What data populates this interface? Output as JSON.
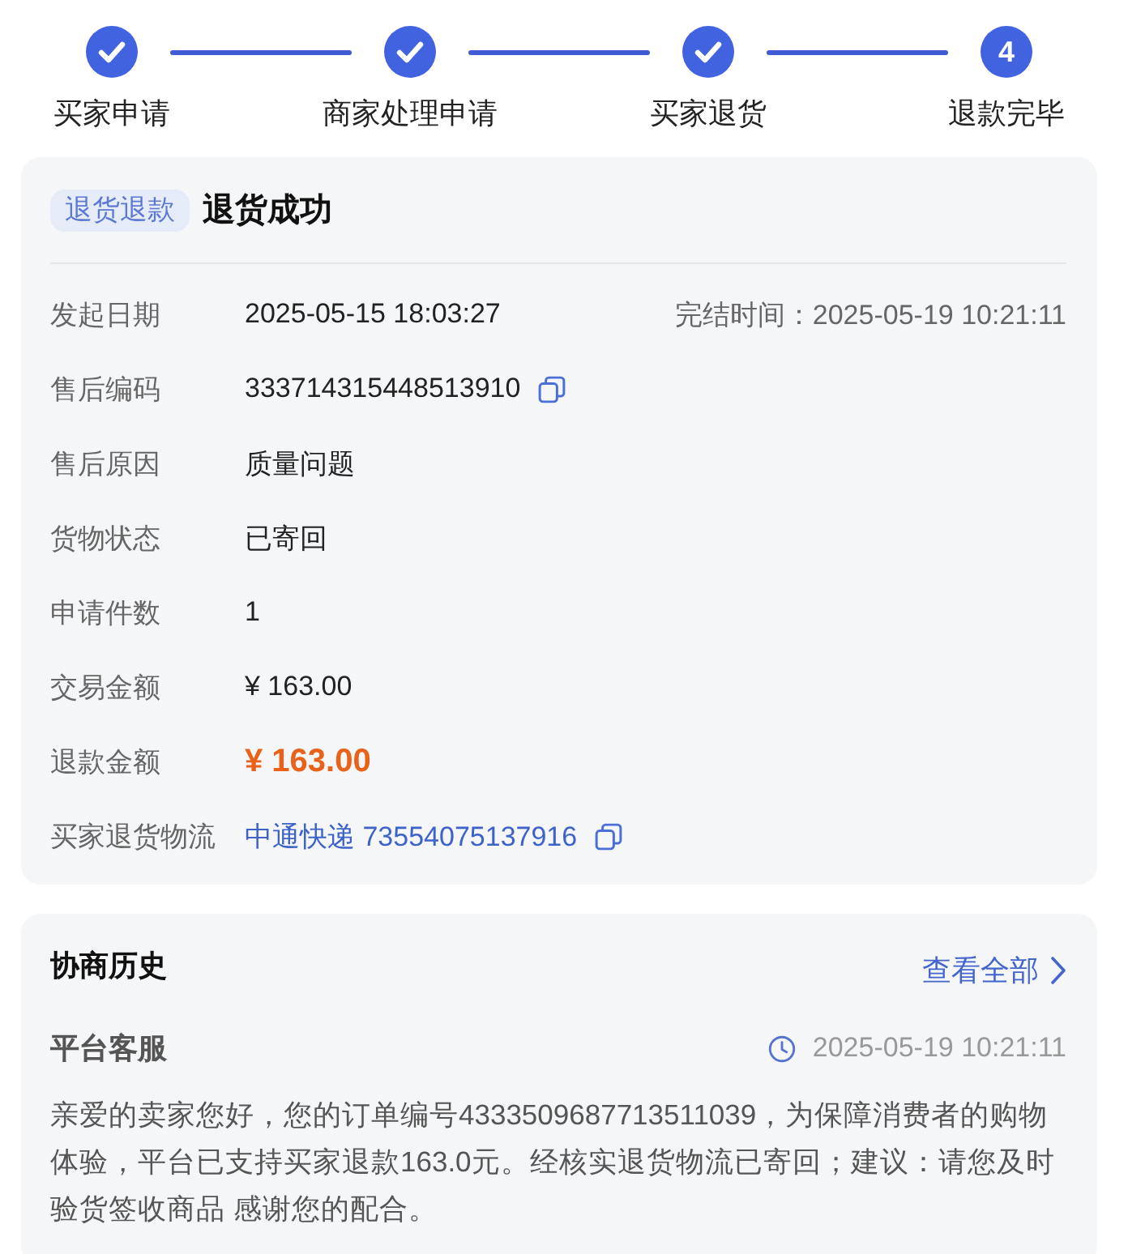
{
  "steps": [
    {
      "label": "买家申请",
      "kind": "done"
    },
    {
      "label": "商家处理申请",
      "kind": "done"
    },
    {
      "label": "买家退货",
      "kind": "done"
    },
    {
      "label": "退款完毕",
      "kind": "current",
      "number": "4"
    }
  ],
  "summary": {
    "tag": "退货退款",
    "title": "退货成功"
  },
  "details": [
    {
      "label": "发起日期",
      "value": "2025-05-15 18:03:27",
      "kind": "plain",
      "copyable": false,
      "aside": "完结时间：2025-05-19 10:21:11"
    },
    {
      "label": "售后编码",
      "value": "333714315448513910",
      "kind": "plain",
      "copyable": true
    },
    {
      "label": "售后原因",
      "value": "质量问题",
      "kind": "plain",
      "copyable": false
    },
    {
      "label": "货物状态",
      "value": "已寄回",
      "kind": "plain",
      "copyable": false
    },
    {
      "label": "申请件数",
      "value": "1",
      "kind": "plain",
      "copyable": false
    },
    {
      "label": "交易金额",
      "value": "¥ 163.00",
      "kind": "plain",
      "copyable": false
    },
    {
      "label": "退款金额",
      "value": "¥ 163.00",
      "kind": "amount",
      "copyable": false
    },
    {
      "label": "买家退货物流",
      "value": "中通快递 73554075137916",
      "kind": "link",
      "copyable": true
    }
  ],
  "history": {
    "title": "协商历史",
    "view_all": "查看全部",
    "entries": [
      {
        "author": "平台客服",
        "time": "2025-05-19 10:21:11",
        "message": "亲爱的卖家您好，您的订单编号4333509687713511039，为保障消费者的购物体验，平台已支持买家退款163.0元。经核实退货物流已寄回；建议：请您及时验货签收商品 感谢您的配合。"
      }
    ]
  }
}
